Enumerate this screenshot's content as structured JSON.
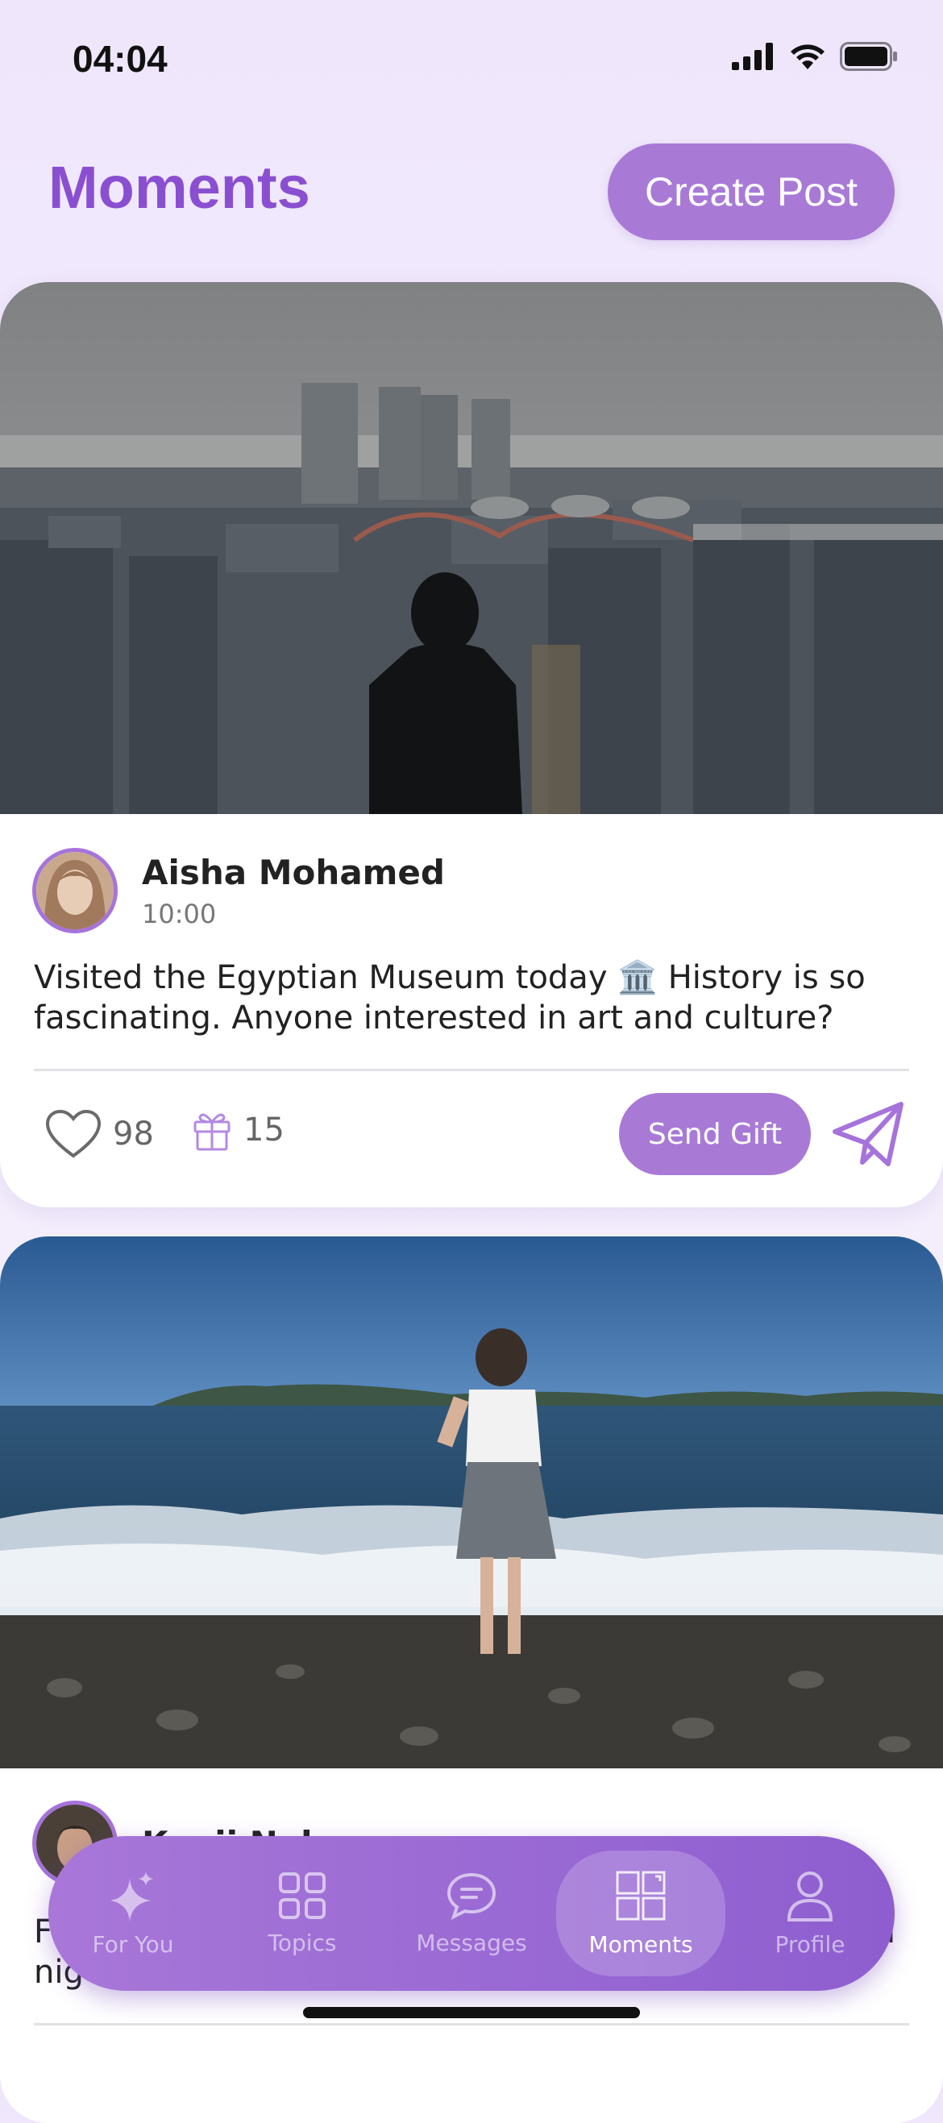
{
  "status": {
    "time": "04:04"
  },
  "header": {
    "title": "Moments",
    "create_label": "Create Post"
  },
  "posts": [
    {
      "author": "Aisha Mohamed",
      "time": "10:00",
      "text": "Visited the Egyptian Museum today 🏛️ History is so fascinating. Anyone interested in art and culture?",
      "likes": "98",
      "gifts": "15",
      "send_gift_label": "Send Gift"
    },
    {
      "author": "Kenji Nakamura",
      "text_start": "F",
      "text_start2": "nig",
      "text_end": "l"
    }
  ],
  "tabs": [
    {
      "label": "For You",
      "icon": "sparkle-icon"
    },
    {
      "label": "Topics",
      "icon": "grid-icon"
    },
    {
      "label": "Messages",
      "icon": "chat-icon"
    },
    {
      "label": "Moments",
      "icon": "moments-icon"
    },
    {
      "label": "Profile",
      "icon": "person-icon"
    }
  ],
  "colors": {
    "accent": "#a87ad6",
    "title": "#8a4fd0",
    "tabbar": "#9a68d4"
  }
}
